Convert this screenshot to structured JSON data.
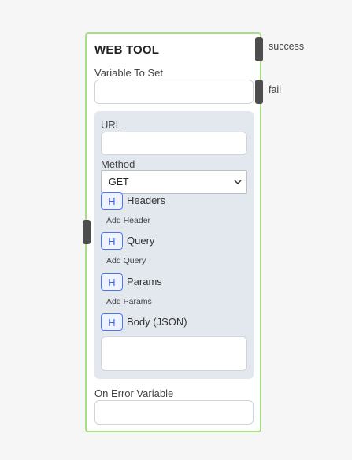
{
  "node": {
    "title": "WEB TOOL",
    "variable_to_set_label": "Variable To Set",
    "variable_to_set_value": "",
    "config": {
      "url_label": "URL",
      "url_value": "",
      "method_label": "Method",
      "method_value": "GET",
      "sections": [
        {
          "button": "H",
          "label": "Headers",
          "add_label": "Add Header"
        },
        {
          "button": "H",
          "label": "Query",
          "add_label": "Add Query"
        },
        {
          "button": "H",
          "label": "Params",
          "add_label": "Add Params"
        },
        {
          "button": "H",
          "label": "Body (JSON)"
        }
      ],
      "body_value": ""
    },
    "on_error_label": "On Error Variable",
    "on_error_value": ""
  },
  "outputs": {
    "success_label": "success",
    "fail_label": "fail"
  },
  "colors": {
    "node_border": "#a8df83",
    "panel_bg": "#e3e8ef",
    "h_button_border": "#4a78f5",
    "handle": "#4d4d4d"
  }
}
